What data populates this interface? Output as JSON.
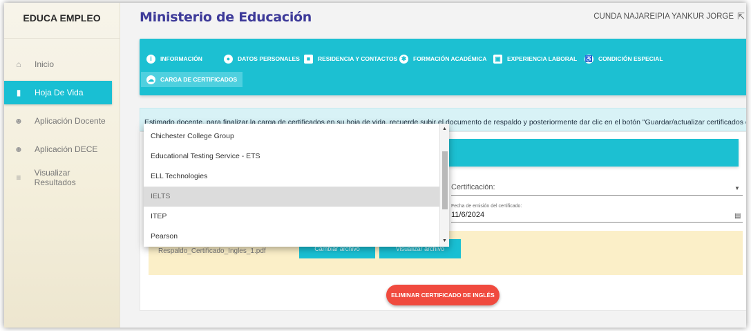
{
  "sidebar": {
    "brand": "EDUCA EMPLEO",
    "items": [
      {
        "label": "Inicio",
        "icon": "home-icon"
      },
      {
        "label": "Hoja De Vida",
        "icon": "document-icon",
        "active": true
      },
      {
        "label": "Aplicación Docente",
        "icon": "user-icon"
      },
      {
        "label": "Aplicación DECE",
        "icon": "user-icon"
      },
      {
        "label": "Visualizar Resultados",
        "icon": "list-search-icon"
      }
    ]
  },
  "header": {
    "title": "Ministerio de Educación",
    "user": "CUNDA NAJAREIPIA YANKUR JORGE"
  },
  "tabs": [
    {
      "label": "INFORMACIÓN",
      "icon": "info-icon"
    },
    {
      "label": "DATOS PERSONALES",
      "icon": "account-icon"
    },
    {
      "label": "RESIDENCIA Y CONTACTOS",
      "icon": "contact-icon"
    },
    {
      "label": "FORMACIÓN ACADÉMICA",
      "icon": "puzzle-icon"
    },
    {
      "label": "EXPERIENCIA LABORAL",
      "icon": "briefcase-icon"
    },
    {
      "label": "CONDICIÓN ESPECIAL",
      "icon": "accessibility-icon"
    },
    {
      "label": "CARGA DE CERTIFICADOS",
      "icon": "cloud-upload-icon",
      "active": true
    }
  ],
  "info_text": "Estimado docente, para finalizar la carga de certificados en su hoja de vida, recuerde subir el documento de respaldo y posteriormente dar clic en el botón \"Guardar/actualizar certificados en la hoja de vida\".",
  "form": {
    "certificacion_label": "Certificación:",
    "fecha_label": "Fecha de emisión del certificado:",
    "fecha_value": "11/6/2024",
    "file_name": "Respaldo_Certificado_Ingles_1.pdf",
    "btn_cambiar": "Cambiar archivo",
    "btn_visualizar": "Visualizar archivo",
    "btn_eliminar": "ELIMINAR CERTIFICADO DE INGLÉS"
  },
  "dropdown": {
    "options": [
      "Chichester College Group",
      "Educational Testing Service - ETS",
      "ELL Technologies",
      "IELTS",
      "ITEP",
      "Pearson"
    ],
    "selected": "IELTS"
  },
  "colors": {
    "accent": "#1cc0d2",
    "title": "#3d3a99",
    "danger": "#f04a3e",
    "warning_bg": "#fbefc8"
  }
}
